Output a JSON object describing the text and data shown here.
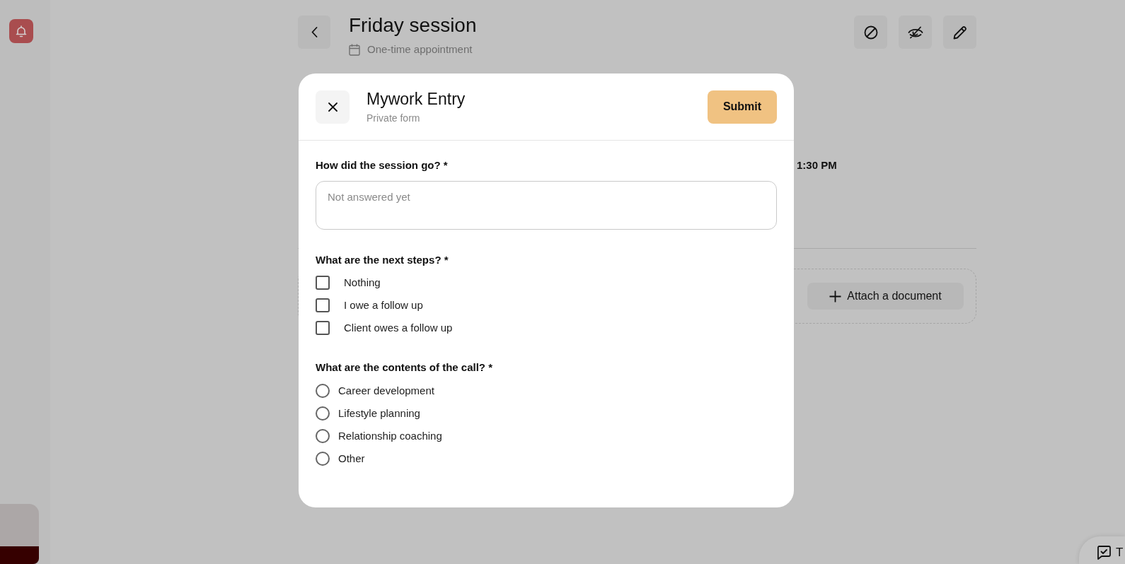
{
  "header": {
    "title": "Friday session",
    "subtitle": "One-time appointment"
  },
  "background": {
    "time": "1:30 PM",
    "attach_button": "Attach a document"
  },
  "floating_button": {
    "label": "T"
  },
  "modal": {
    "title": "Mywork Entry",
    "subtitle": "Private form",
    "submit": "Submit",
    "questions": [
      {
        "kind": "text",
        "label": "How did the session go? *",
        "placeholder": "Not answered yet"
      },
      {
        "kind": "checkbox",
        "label": "What are the next steps? *",
        "options": [
          {
            "label": "Nothing",
            "checked": false
          },
          {
            "label": "I owe a follow up",
            "checked": false
          },
          {
            "label": "Client owes a follow up",
            "checked": false
          }
        ]
      },
      {
        "kind": "radio",
        "label": "What are the contents of the call? *",
        "options": [
          {
            "label": "Career development",
            "selected": false
          },
          {
            "label": "Lifestyle planning",
            "selected": false
          },
          {
            "label": "Relationship coaching",
            "selected": false
          },
          {
            "label": "Other",
            "selected": false
          }
        ]
      }
    ]
  }
}
